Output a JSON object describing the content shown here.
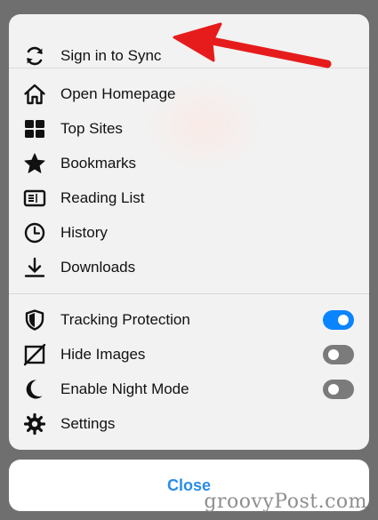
{
  "menu": {
    "sync": {
      "label": "Sign in to Sync",
      "icon": "sync-icon"
    },
    "items": [
      {
        "label": "Open Homepage",
        "icon": "home-icon"
      },
      {
        "label": "Top Sites",
        "icon": "grid-icon"
      },
      {
        "label": "Bookmarks",
        "icon": "star-icon"
      },
      {
        "label": "Reading List",
        "icon": "reading-list-icon"
      },
      {
        "label": "History",
        "icon": "clock-icon"
      },
      {
        "label": "Downloads",
        "icon": "download-icon"
      }
    ],
    "toggles": [
      {
        "label": "Tracking Protection",
        "icon": "shield-icon",
        "on": true
      },
      {
        "label": "Hide Images",
        "icon": "hide-images-icon",
        "on": false
      },
      {
        "label": "Enable Night Mode",
        "icon": "moon-icon",
        "on": false
      }
    ],
    "settings": {
      "label": "Settings",
      "icon": "gear-icon"
    }
  },
  "close": {
    "label": "Close"
  },
  "watermark": "groovyPost.com",
  "colors": {
    "accent": "#0a84ff",
    "close_text": "#2a8ce8",
    "toggle_off": "#7b7b7b",
    "annotation_arrow": "#e61c1c"
  }
}
